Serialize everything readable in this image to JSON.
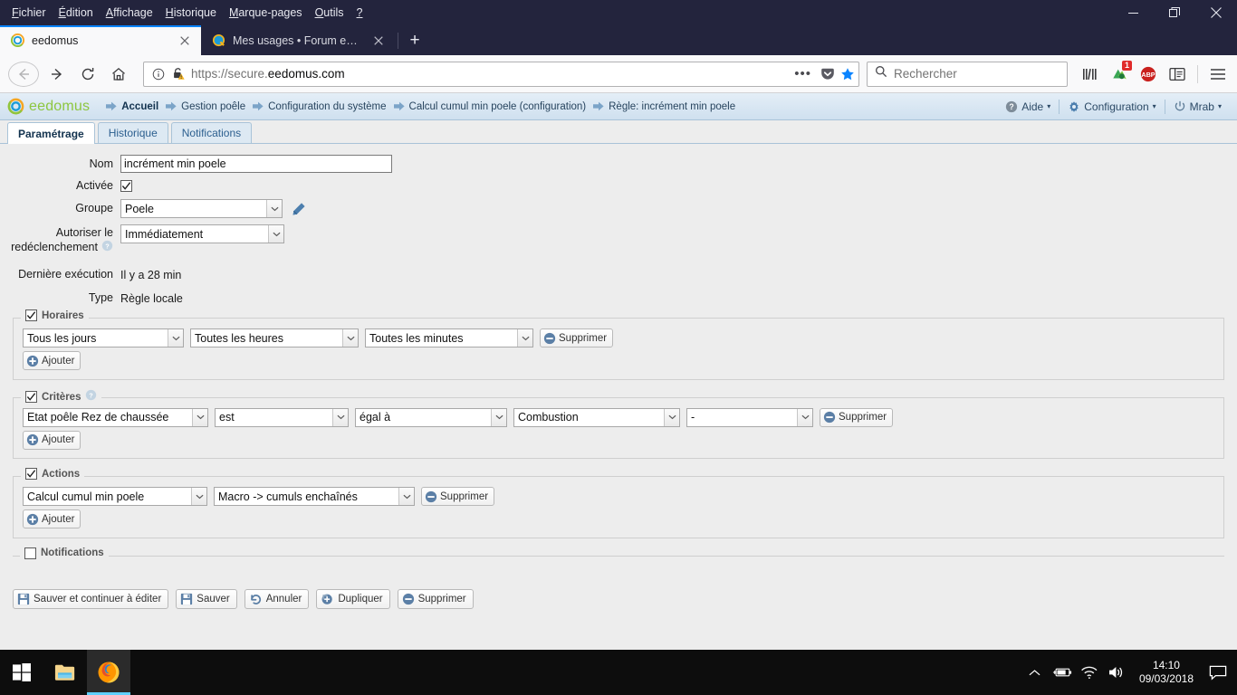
{
  "browser": {
    "menus": [
      "Fichier",
      "Édition",
      "Affichage",
      "Historique",
      "Marque-pages",
      "Outils",
      "?"
    ],
    "window_controls": {
      "minimize": "minimize-icon",
      "restore": "restore-icon",
      "close": "close-icon"
    },
    "tabs": [
      {
        "title": "eedomus",
        "favicon": "eedomus-favicon",
        "active": true
      },
      {
        "title": "Mes usages • Forum eedomus",
        "favicon": "forum-favicon",
        "active": false
      }
    ],
    "new_tab_label": "+",
    "nav": {
      "back": "back-arrow-icon",
      "forward": "forward-arrow-icon",
      "reload": "reload-icon",
      "home": "home-icon"
    },
    "url": {
      "scheme": "https://secure.",
      "domain": "eedomus.com",
      "full": "https://secure.eedomus.com",
      "info_icon": "page-info-icon",
      "lock_icon": "lock-warning-icon",
      "page_actions": "ellipsis-icon",
      "pocket": "pocket-icon",
      "bookmark": "star-icon-filled"
    },
    "search": {
      "placeholder": "Rechercher",
      "icon": "search-icon"
    },
    "toolbar_icons": [
      {
        "name": "library-icon",
        "badge": ""
      },
      {
        "name": "extension-icon",
        "badge": "1"
      },
      {
        "name": "adblock-plus-icon",
        "badge": ""
      },
      {
        "name": "sidebar-icon",
        "badge": ""
      },
      {
        "name": "hamburger-menu-icon",
        "badge": ""
      }
    ]
  },
  "app": {
    "brand": "eedomus",
    "breadcrumbs": [
      "Accueil",
      "Gestion poêle",
      "Configuration du système",
      "Calcul cumul min poele (configuration)",
      "Règle: incrément min poele"
    ],
    "header_right": [
      {
        "label": "Aide",
        "icon": "help-icon",
        "caret": "▾"
      },
      {
        "label": "Configuration",
        "icon": "gear-icon",
        "caret": "▾"
      },
      {
        "label": "Mrab",
        "icon": "power-icon",
        "caret": "▾"
      }
    ],
    "tabs": [
      {
        "label": "Paramétrage",
        "active": true
      },
      {
        "label": "Historique",
        "active": false
      },
      {
        "label": "Notifications",
        "active": false
      }
    ],
    "fields": {
      "nom": {
        "label": "Nom",
        "value": "incrément min poele"
      },
      "activee": {
        "label": "Activée",
        "checked": true
      },
      "groupe": {
        "label": "Groupe",
        "value": "Poele",
        "edit_icon": "pencil-icon"
      },
      "redeclenchement": {
        "label_line1": "Autoriser le",
        "label_line2": "redéclenchement",
        "value": "Immédiatement",
        "help_icon": "help-bubble-icon"
      },
      "derniere_execution": {
        "label": "Dernière exécution",
        "value": "Il y a 28 min"
      },
      "type": {
        "label": "Type",
        "value": "Règle locale"
      }
    },
    "sections": {
      "horaires": {
        "legend": "Horaires",
        "checked": true,
        "rows": [
          {
            "selects": [
              "Tous les jours",
              "Toutes les heures",
              "Toutes les minutes"
            ],
            "delete_label": "Supprimer"
          }
        ],
        "add_label": "Ajouter"
      },
      "criteres": {
        "legend": "Critères",
        "checked": true,
        "help_icon": "help-bubble-icon",
        "rows": [
          {
            "selects": [
              "Etat poêle Rez de chaussée",
              "est",
              "égal à",
              "Combustion",
              "-"
            ],
            "delete_label": "Supprimer"
          }
        ],
        "add_label": "Ajouter"
      },
      "actions": {
        "legend": "Actions",
        "checked": true,
        "rows": [
          {
            "selects": [
              "Calcul cumul min poele",
              "Macro -> cumuls enchaînés"
            ],
            "delete_label": "Supprimer"
          }
        ],
        "add_label": "Ajouter"
      },
      "notifications": {
        "legend": "Notifications",
        "checked": false
      }
    },
    "buttons": [
      {
        "label": "Sauver et continuer à éditer",
        "icon": "save-icon"
      },
      {
        "label": "Sauver",
        "icon": "save-icon"
      },
      {
        "label": "Annuler",
        "icon": "undo-icon"
      },
      {
        "label": "Dupliquer",
        "icon": "duplicate-icon"
      },
      {
        "label": "Supprimer",
        "icon": "minus-circle-icon"
      }
    ]
  },
  "taskbar": {
    "start": "windows-start-icon",
    "apps": [
      {
        "name": "file-explorer-icon",
        "running": false
      },
      {
        "name": "firefox-icon",
        "running": true
      }
    ],
    "tray": [
      {
        "name": "show-hidden-icons-chevron"
      },
      {
        "name": "battery-icon"
      },
      {
        "name": "wifi-icon"
      },
      {
        "name": "volume-icon"
      }
    ],
    "clock": {
      "time": "14:10",
      "date": "09/03/2018"
    },
    "action_center": "notification-icon"
  },
  "colors": {
    "chrome_dark": "#23243d",
    "accent_blue": "#0a84ff",
    "brand_green": "#8dc63f",
    "header_blue": "#cfe0ef",
    "page_bg": "#ededed"
  }
}
